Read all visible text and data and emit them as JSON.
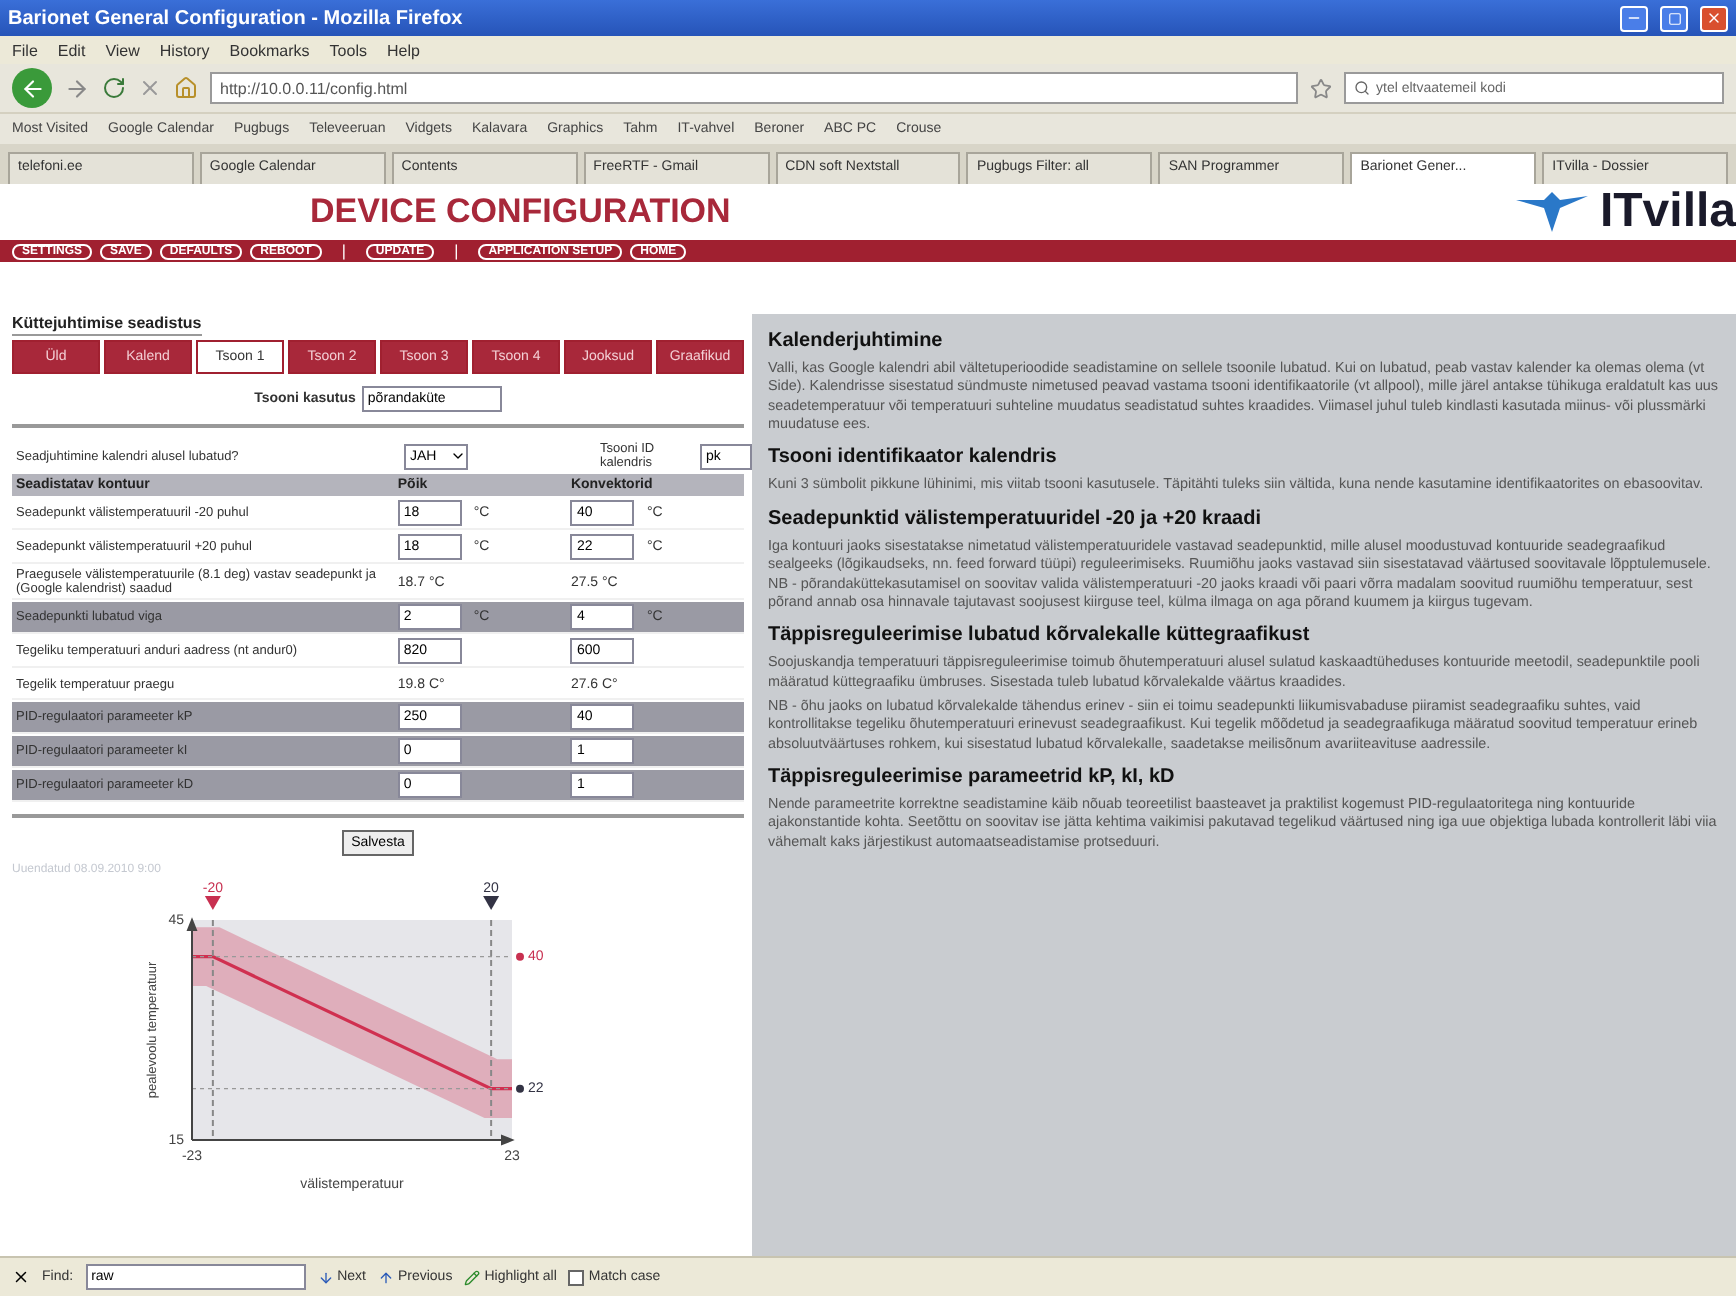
{
  "browser": {
    "title": "Barionet General Configuration - Mozilla Firefox",
    "menu": [
      "File",
      "Edit",
      "View",
      "History",
      "Bookmarks",
      "Tools",
      "Help"
    ],
    "url": "http://10.0.0.11/config.html",
    "search": "ytel eltvaatemeil kodi",
    "bookmarks": [
      "Most Visited",
      "Google Calendar",
      "Pugbugs",
      "Televeeruan",
      "Vidgets",
      "Kalavara",
      "Graphics",
      "Tahm",
      "IT-vahvel",
      "Beroner",
      "ABC PC",
      "Crouse"
    ],
    "tabs": [
      {
        "label": "telefoni.ee",
        "selected": false
      },
      {
        "label": "Google Calendar",
        "selected": false
      },
      {
        "label": "Contents",
        "selected": false
      },
      {
        "label": "FreeRTF - Gmail",
        "selected": false
      },
      {
        "label": "CDN soft Nextstall",
        "selected": false
      },
      {
        "label": "Pugbugs Filter: all",
        "selected": false
      },
      {
        "label": "SAN Programmer",
        "selected": false
      },
      {
        "label": "Barionet Gener...",
        "selected": true
      },
      {
        "label": "ITvilla - Dossier",
        "selected": false
      }
    ]
  },
  "page": {
    "heading": "DEVICE CONFIGURATION",
    "logo": "ITvilla",
    "nav": [
      {
        "kind": "button",
        "label": "SETTINGS"
      },
      {
        "kind": "button",
        "label": "SAVE"
      },
      {
        "kind": "button",
        "label": "DEFAULTS"
      },
      {
        "kind": "button",
        "label": "REBOOT"
      },
      {
        "kind": "separator",
        "label": "|"
      },
      {
        "kind": "button",
        "label": "UPDATE"
      },
      {
        "kind": "separator",
        "label": "|"
      },
      {
        "kind": "button",
        "label": "APPLICATION SETUP"
      },
      {
        "kind": "button",
        "label": "HOME"
      }
    ]
  },
  "form": {
    "title": "Küttejuhtimise seadistus",
    "tabs": [
      {
        "label": "Üld",
        "selected": false
      },
      {
        "label": "Kalend",
        "selected": false
      },
      {
        "label": "Tsoon 1",
        "selected": true
      },
      {
        "label": "Tsoon 2",
        "selected": false
      },
      {
        "label": "Tsoon 3",
        "selected": false
      },
      {
        "label": "Tsoon 4",
        "selected": false
      },
      {
        "label": "Jooksud",
        "selected": false
      },
      {
        "label": "Graafikud",
        "selected": false
      }
    ],
    "usage_label": "Tsooni kasutus",
    "usage_value": "põrandaküte",
    "calendar_label": "Seadjuhtimine kalendri alusel lubatud?",
    "calendar_value": "JAH",
    "calendar_id_label": "Tsooni ID kalendris",
    "calendar_id_value": "pk",
    "label_column": "Seadistatav kontuur",
    "columns": [
      "Põik",
      "Konvektorid"
    ],
    "rows": [
      {
        "kind": "input",
        "shaded": false,
        "label": "Seadepunkt välistemperatuuril -20 puhul",
        "cells": [
          {
            "value": "18",
            "unit": "°C"
          },
          {
            "value": "40",
            "unit": "°C"
          }
        ]
      },
      {
        "kind": "input",
        "shaded": false,
        "label": "Seadepunkt välistemperatuuril +20 puhul",
        "cells": [
          {
            "value": "18",
            "unit": "°C"
          },
          {
            "value": "22",
            "unit": "°C"
          }
        ]
      },
      {
        "kind": "text",
        "shaded": false,
        "label": "Praegusele välistemperatuurile (8.1 deg) vastav seadepunkt ja (Google kalendrist) saadud",
        "cells": [
          {
            "value": "18.7 °C"
          },
          {
            "value": "27.5 °C"
          }
        ]
      },
      {
        "kind": "input",
        "shaded": true,
        "label": "Seadepunkti lubatud viga",
        "cells": [
          {
            "value": "2",
            "unit": "°C"
          },
          {
            "value": "4",
            "unit": "°C"
          }
        ]
      },
      {
        "kind": "input",
        "shaded": false,
        "label": "Tegeliku temperatuuri anduri aadress (nt andur0)",
        "cells": [
          {
            "value": "820"
          },
          {
            "value": "600"
          }
        ]
      },
      {
        "kind": "text",
        "shaded": false,
        "label": "Tegelik temperatuur praegu",
        "cells": [
          {
            "value": "19.8 C°"
          },
          {
            "value": "27.6 C°"
          }
        ]
      },
      {
        "kind": "input",
        "shaded": true,
        "label": "PID-regulaatori parameeter kP",
        "cells": [
          {
            "value": "250"
          },
          {
            "value": "40"
          }
        ]
      },
      {
        "kind": "input",
        "shaded": true,
        "label": "PID-regulaatori parameeter kI",
        "cells": [
          {
            "value": "0"
          },
          {
            "value": "1"
          }
        ]
      },
      {
        "kind": "input",
        "shaded": true,
        "label": "PID-regulaatori parameeter kD",
        "cells": [
          {
            "value": "0"
          },
          {
            "value": "1"
          }
        ]
      }
    ],
    "save_button": "Salvesta",
    "note": "Uuendatud 08.09.2010 9:00",
    "chart_data": {
      "type": "line",
      "xlabel": "välistemperatuur",
      "ylabel": "pealevoolu temperatuur",
      "x": [
        -23,
        -20,
        20,
        23
      ],
      "series": [
        {
          "color": "#d03050",
          "values": [
            40,
            40,
            22,
            22
          ]
        }
      ],
      "ref_lines": [
        {
          "axis": "x",
          "value": -20
        },
        {
          "axis": "x",
          "value": 20
        },
        {
          "axis": "y",
          "value": 40
        },
        {
          "axis": "y",
          "value": 22
        }
      ],
      "xlim": [
        -23,
        23
      ],
      "ylim": [
        15,
        45
      ],
      "xticks": [
        -23,
        23
      ],
      "yticks": [
        15,
        45
      ],
      "annotations": [
        "-20",
        "20",
        "40",
        "22"
      ]
    }
  },
  "help": [
    {
      "heading": "Kalenderjuhtimine",
      "paragraphs": [
        "Valli, kas Google kalendri abil vältetuperioodide seadistamine on sellele tsoonile lubatud. Kui on lubatud, peab vastav kalender ka olemas olema (vt Side). Kalendrisse sisestatud sündmuste nimetused peavad vastama tsooni identifikaatorile (vt allpool), mille järel antakse tühikuga eraldatult kas uus seadetemperatuur või temperatuuri suhteline muudatus seadistatud suhtes kraadides. Viimasel juhul tuleb kindlasti kasutada miinus- või plussmärki muudatuse ees."
      ]
    },
    {
      "heading": "Tsooni identifikaator kalendris",
      "paragraphs": [
        "Kuni 3 sümbolit pikkune lühinimi, mis viitab tsooni kasutusele. Täpitähti tuleks siin vältida, kuna nende kasutamine identifikaatorites on ebasoovitav."
      ]
    },
    {
      "heading": "Seadepunktid välistemperatuuridel -20 ja +20 kraadi",
      "paragraphs": [
        "Iga kontuuri jaoks sisestatakse nimetatud välistemperatuuridele vastavad seadepunktid, mille alusel moodustuvad kontuuride seadegraafikud sealgeeks (lõgikaudseks, nn. feed forward tüüpi) reguleerimiseks. Ruumiõhu jaoks vastavad siin sisestatavad väärtused soovitavale lõpptulemusele. NB - põrandaküttekasutamisel on soovitav valida välistemperatuuri -20 jaoks kraadi või paari võrra madalam soovitud ruumiõhu temperatuur, sest põrand annab osa hinnavale tajutavast soojusest kiirguse teel, külma ilmaga on aga põrand kuumem ja kiirgus tugevam."
      ]
    },
    {
      "heading": "Täppisreguleerimise lubatud kõrvalekalle küttegraafikust",
      "paragraphs": [
        "Soojuskandja temperatuuri täppisreguleerimise toimub õhutemperatuuri alusel sulatud kaskaadtüheduses kontuuride meetodil, seadepunktile pooli määratud küttegraafiku ümbruses. Sisestada tuleb lubatud kõrvalekalde väärtus kraadides.",
        "NB - õhu jaoks on lubatud kõrvalekalde tähendus erinev - siin ei toimu seadepunkti liikumisvabaduse piiramist seadegraafiku suhtes, vaid kontrollitakse tegeliku õhutemperatuuri erinevust seadegraafikust. Kui tegelik mõõdetud ja seadegraafikuga määratud soovitud temperatuur erineb absoluutväärtuses rohkem, kui sisestatud lubatud kõrvalekalle, saadetakse meilisõnum avariiteavituse aadressile."
      ]
    },
    {
      "heading": "Täppisreguleerimise parameetrid kP, kI, kD",
      "paragraphs": [
        "Nende parameetrite korrektne seadistamine käib nõuab teoreetilist baasteavet ja praktilist kogemust PID-regulaatoritega ning kontuuride ajakonstantide kohta. Seetõttu on soovitav ise jätta kehtima vaikimisi pakutavad tegelikud väärtused ning iga uue objektiga lubada kontrollerit läbi viia vähemalt kaks järjestikust automaatseadistamise protseduuri."
      ]
    }
  ],
  "find_bar": {
    "label": "Find:",
    "value": "raw",
    "buttons": [
      "Next",
      "Previous",
      "Highlight all"
    ],
    "checkbox": {
      "label": "Match case",
      "checked": false
    }
  }
}
